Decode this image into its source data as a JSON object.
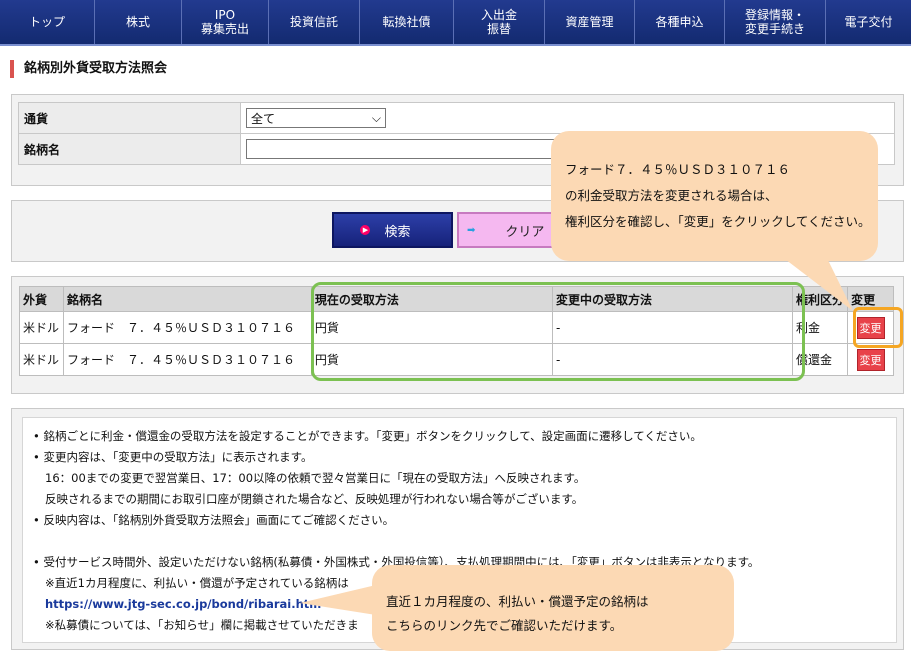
{
  "nav": [
    {
      "label": "トップ"
    },
    {
      "label": "株式"
    },
    {
      "label": "IPO\n募集売出"
    },
    {
      "label": "投資信託"
    },
    {
      "label": "転換社債"
    },
    {
      "label": "入出金\n振替"
    },
    {
      "label": "資産管理"
    },
    {
      "label": "各種申込"
    },
    {
      "label": "登録情報・\n変更手続き"
    },
    {
      "label": "電子交付"
    }
  ],
  "page": {
    "title": "銘柄別外貨受取方法照会"
  },
  "filter": {
    "currency_label": "通貨",
    "currency_value": "全て",
    "name_label": "銘柄名",
    "name_value": ""
  },
  "buttons": {
    "search": "検索",
    "clear": "クリア"
  },
  "table": {
    "headers": [
      "外貨",
      "銘柄名",
      "現在の受取方法",
      "変更中の受取方法",
      "権利区分",
      "変更"
    ],
    "rows": [
      {
        "currency": "米ドル",
        "name": "フォード　７．４５％ＵＳＤ３１０７１６",
        "current": "円貨",
        "pending": "-",
        "right_type": "利金",
        "action": "変更"
      },
      {
        "currency": "米ドル",
        "name": "フォード　７．４５％ＵＳＤ３１０７１６",
        "current": "円貨",
        "pending": "-",
        "right_type": "償還金",
        "action": "変更"
      }
    ]
  },
  "notes": {
    "line1": "• 銘柄ごとに利金・償還金の受取方法を設定することができます。「変更」ボタンをクリックして、設定画面に遷移してください。",
    "line2": "• 変更内容は、「変更中の受取方法」に表示されます。",
    "line3": "16：00までの変更で翌営業日、17：00以降の依頼で翌々営業日に「現在の受取方法」へ反映されます。",
    "line4": "反映されるまでの期間にお取引口座が閉鎖された場合など、反映処理が行われない場合等がございます。",
    "line5": "• 反映内容は、「銘柄別外貨受取方法照会」画面にてご確認ください。",
    "line6": "• 受付サービス時間外、設定いただけない銘柄(私募債・外国株式・外国投信等）、支払処理期間中には、「変更」ボタンは非表示となります。",
    "line7": "※直近1カ月程度に、利払い・償還が予定されている銘柄は",
    "link": "https://www.jtg-sec.co.jp/bond/ribarai.htm",
    "line8": "※私募債については、「お知らせ」欄に掲載させていただきま"
  },
  "callouts": {
    "top": {
      "line1": "フォード７．４５％ＵＳＤ３１０７１６",
      "line2": "の利金受取方法を変更される場合は、",
      "line3": "権利区分を確認し、「変更」をクリックしてください。"
    },
    "bottom": {
      "line1": "直近１カ月程度の、利払い・償還予定の銘柄は",
      "line2": "こちらのリンク先でご確認いただけます。"
    }
  },
  "colors": {
    "nav": "#1c3282",
    "highlight_green": "#7cc152",
    "highlight_orange": "#f5a623",
    "callout": "#fcd9b4",
    "change_button": "#e8424a"
  }
}
